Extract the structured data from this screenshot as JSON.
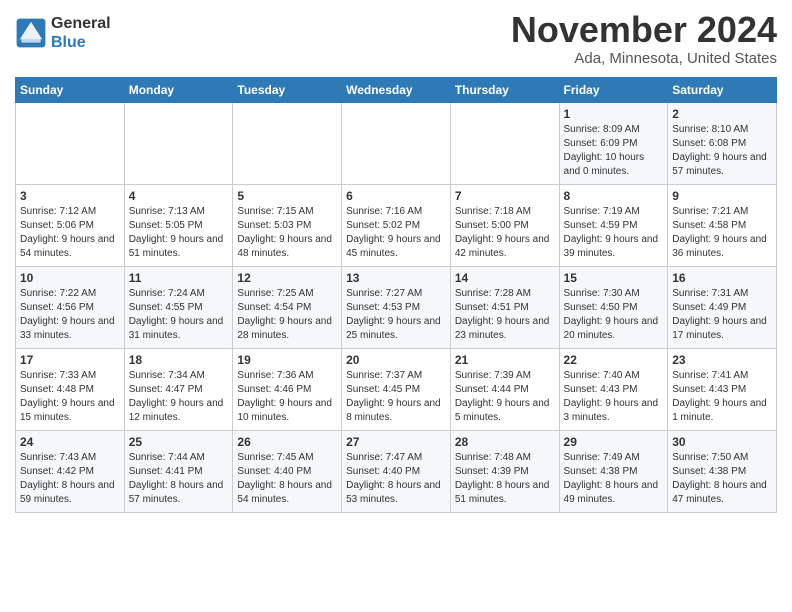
{
  "header": {
    "logo_line1": "General",
    "logo_line2": "Blue",
    "month": "November 2024",
    "location": "Ada, Minnesota, United States"
  },
  "days_of_week": [
    "Sunday",
    "Monday",
    "Tuesday",
    "Wednesday",
    "Thursday",
    "Friday",
    "Saturday"
  ],
  "weeks": [
    [
      {
        "day": "",
        "detail": ""
      },
      {
        "day": "",
        "detail": ""
      },
      {
        "day": "",
        "detail": ""
      },
      {
        "day": "",
        "detail": ""
      },
      {
        "day": "",
        "detail": ""
      },
      {
        "day": "1",
        "detail": "Sunrise: 8:09 AM\nSunset: 6:09 PM\nDaylight: 10 hours\nand 0 minutes."
      },
      {
        "day": "2",
        "detail": "Sunrise: 8:10 AM\nSunset: 6:08 PM\nDaylight: 9 hours\nand 57 minutes."
      }
    ],
    [
      {
        "day": "3",
        "detail": "Sunrise: 7:12 AM\nSunset: 5:06 PM\nDaylight: 9 hours\nand 54 minutes."
      },
      {
        "day": "4",
        "detail": "Sunrise: 7:13 AM\nSunset: 5:05 PM\nDaylight: 9 hours\nand 51 minutes."
      },
      {
        "day": "5",
        "detail": "Sunrise: 7:15 AM\nSunset: 5:03 PM\nDaylight: 9 hours\nand 48 minutes."
      },
      {
        "day": "6",
        "detail": "Sunrise: 7:16 AM\nSunset: 5:02 PM\nDaylight: 9 hours\nand 45 minutes."
      },
      {
        "day": "7",
        "detail": "Sunrise: 7:18 AM\nSunset: 5:00 PM\nDaylight: 9 hours\nand 42 minutes."
      },
      {
        "day": "8",
        "detail": "Sunrise: 7:19 AM\nSunset: 4:59 PM\nDaylight: 9 hours\nand 39 minutes."
      },
      {
        "day": "9",
        "detail": "Sunrise: 7:21 AM\nSunset: 4:58 PM\nDaylight: 9 hours\nand 36 minutes."
      }
    ],
    [
      {
        "day": "10",
        "detail": "Sunrise: 7:22 AM\nSunset: 4:56 PM\nDaylight: 9 hours\nand 33 minutes."
      },
      {
        "day": "11",
        "detail": "Sunrise: 7:24 AM\nSunset: 4:55 PM\nDaylight: 9 hours\nand 31 minutes."
      },
      {
        "day": "12",
        "detail": "Sunrise: 7:25 AM\nSunset: 4:54 PM\nDaylight: 9 hours\nand 28 minutes."
      },
      {
        "day": "13",
        "detail": "Sunrise: 7:27 AM\nSunset: 4:53 PM\nDaylight: 9 hours\nand 25 minutes."
      },
      {
        "day": "14",
        "detail": "Sunrise: 7:28 AM\nSunset: 4:51 PM\nDaylight: 9 hours\nand 23 minutes."
      },
      {
        "day": "15",
        "detail": "Sunrise: 7:30 AM\nSunset: 4:50 PM\nDaylight: 9 hours\nand 20 minutes."
      },
      {
        "day": "16",
        "detail": "Sunrise: 7:31 AM\nSunset: 4:49 PM\nDaylight: 9 hours\nand 17 minutes."
      }
    ],
    [
      {
        "day": "17",
        "detail": "Sunrise: 7:33 AM\nSunset: 4:48 PM\nDaylight: 9 hours\nand 15 minutes."
      },
      {
        "day": "18",
        "detail": "Sunrise: 7:34 AM\nSunset: 4:47 PM\nDaylight: 9 hours\nand 12 minutes."
      },
      {
        "day": "19",
        "detail": "Sunrise: 7:36 AM\nSunset: 4:46 PM\nDaylight: 9 hours\nand 10 minutes."
      },
      {
        "day": "20",
        "detail": "Sunrise: 7:37 AM\nSunset: 4:45 PM\nDaylight: 9 hours\nand 8 minutes."
      },
      {
        "day": "21",
        "detail": "Sunrise: 7:39 AM\nSunset: 4:44 PM\nDaylight: 9 hours\nand 5 minutes."
      },
      {
        "day": "22",
        "detail": "Sunrise: 7:40 AM\nSunset: 4:43 PM\nDaylight: 9 hours\nand 3 minutes."
      },
      {
        "day": "23",
        "detail": "Sunrise: 7:41 AM\nSunset: 4:43 PM\nDaylight: 9 hours\nand 1 minute."
      }
    ],
    [
      {
        "day": "24",
        "detail": "Sunrise: 7:43 AM\nSunset: 4:42 PM\nDaylight: 8 hours\nand 59 minutes."
      },
      {
        "day": "25",
        "detail": "Sunrise: 7:44 AM\nSunset: 4:41 PM\nDaylight: 8 hours\nand 57 minutes."
      },
      {
        "day": "26",
        "detail": "Sunrise: 7:45 AM\nSunset: 4:40 PM\nDaylight: 8 hours\nand 54 minutes."
      },
      {
        "day": "27",
        "detail": "Sunrise: 7:47 AM\nSunset: 4:40 PM\nDaylight: 8 hours\nand 53 minutes."
      },
      {
        "day": "28",
        "detail": "Sunrise: 7:48 AM\nSunset: 4:39 PM\nDaylight: 8 hours\nand 51 minutes."
      },
      {
        "day": "29",
        "detail": "Sunrise: 7:49 AM\nSunset: 4:38 PM\nDaylight: 8 hours\nand 49 minutes."
      },
      {
        "day": "30",
        "detail": "Sunrise: 7:50 AM\nSunset: 4:38 PM\nDaylight: 8 hours\nand 47 minutes."
      }
    ]
  ]
}
